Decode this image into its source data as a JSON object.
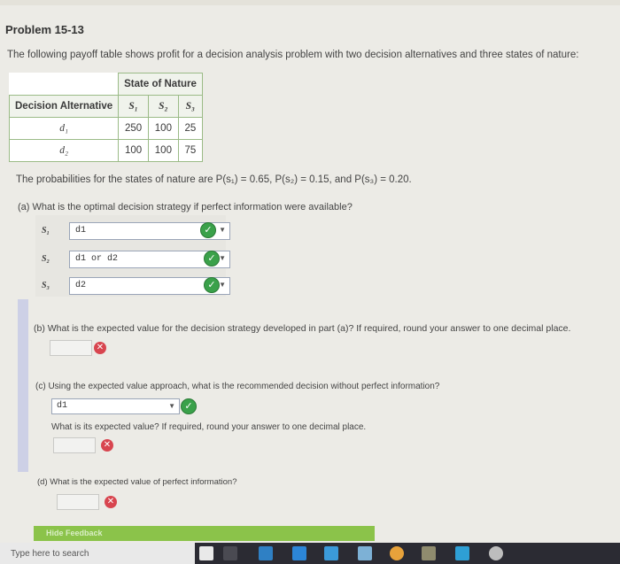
{
  "header": {
    "title": "Problem 15-13"
  },
  "intro": "The following payoff table shows profit for a decision analysis problem with two decision alternatives and three states of nature:",
  "table": {
    "top_header": "State of Nature",
    "row_header": "Decision Alternative",
    "states": [
      "S₁",
      "S₂",
      "S₃"
    ],
    "rows": [
      {
        "label": "d₁",
        "values": [
          "250",
          "100",
          "25"
        ]
      },
      {
        "label": "d₂",
        "values": [
          "100",
          "100",
          "75"
        ]
      }
    ]
  },
  "probabilities": "The probabilities for the states of nature are P(s₁) = 0.65, P(s₂) = 0.15, and P(s₃) = 0.20.",
  "part_a": {
    "question": "(a) What is the optimal decision strategy if perfect information were available?",
    "answers": [
      {
        "label": "S₁",
        "value": "d1"
      },
      {
        "label": "S₂",
        "value": "d1 or d2"
      },
      {
        "label": "S₃",
        "value": "d2"
      }
    ]
  },
  "part_b": {
    "question": "(b) What is the expected value for the decision strategy developed in part (a)? If required, round your answer to one decimal place.",
    "value": ""
  },
  "part_c": {
    "question": "(c) Using the expected value approach, what is the recommended decision without perfect information?",
    "decision": "d1",
    "ev_question": "What is its expected value? If required, round your answer to one decimal place.",
    "ev_value": ""
  },
  "part_d": {
    "question": "(d) What is the expected value of perfect information?",
    "value": ""
  },
  "feedback": {
    "label": "Hide Feedback"
  },
  "taskbar": {
    "search_placeholder": "Type here to search"
  }
}
